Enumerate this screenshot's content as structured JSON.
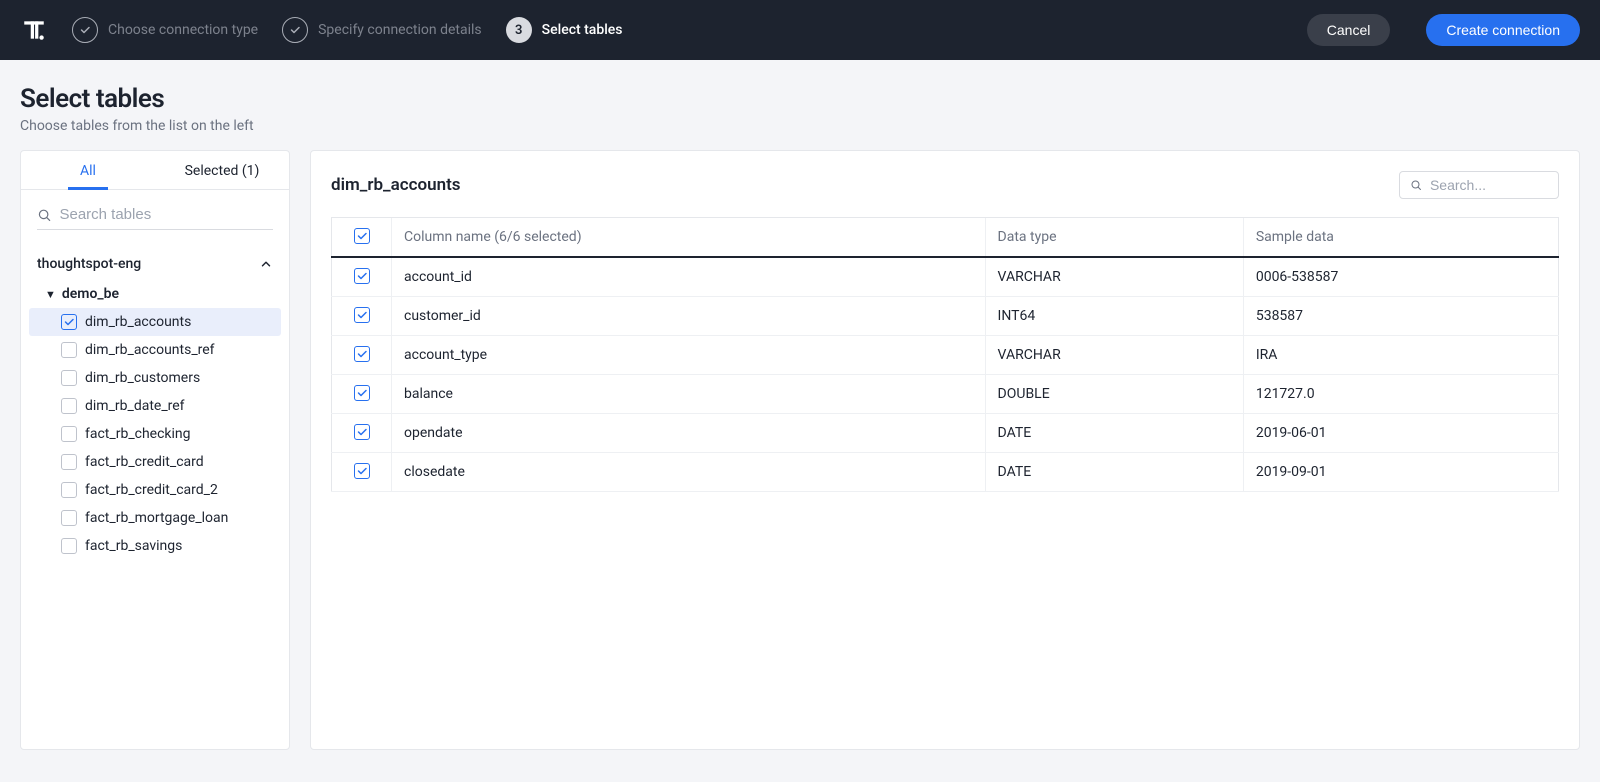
{
  "header": {
    "steps": [
      {
        "label": "Choose connection type",
        "state": "done"
      },
      {
        "label": "Specify connection details",
        "state": "done"
      },
      {
        "number": "3",
        "label": "Select tables",
        "state": "current"
      }
    ],
    "cancel": "Cancel",
    "create": "Create connection"
  },
  "page": {
    "title": "Select tables",
    "subtitle": "Choose tables from the list on the left"
  },
  "sidebar": {
    "tabs": {
      "all": "All",
      "selected": "Selected (1)"
    },
    "search_placeholder": "Search tables",
    "database": "thoughtspot-eng",
    "schema": "demo_be",
    "tables": [
      {
        "name": "dim_rb_accounts",
        "checked": true,
        "selected": true
      },
      {
        "name": "dim_rb_accounts_ref",
        "checked": false
      },
      {
        "name": "dim_rb_customers",
        "checked": false
      },
      {
        "name": "dim_rb_date_ref",
        "checked": false
      },
      {
        "name": "fact_rb_checking",
        "checked": false
      },
      {
        "name": "fact_rb_credit_card",
        "checked": false
      },
      {
        "name": "fact_rb_credit_card_2",
        "checked": false
      },
      {
        "name": "fact_rb_mortgage_loan",
        "checked": false
      },
      {
        "name": "fact_rb_savings",
        "checked": false
      }
    ]
  },
  "main": {
    "table_name": "dim_rb_accounts",
    "search_placeholder": "Search...",
    "headers": {
      "col_name": "Column name (6/6 selected)",
      "data_type": "Data type",
      "sample": "Sample data"
    },
    "columns": [
      {
        "name": "account_id",
        "type": "VARCHAR",
        "sample": "0006-538587",
        "checked": true
      },
      {
        "name": "customer_id",
        "type": "INT64",
        "sample": "538587",
        "checked": true
      },
      {
        "name": "account_type",
        "type": "VARCHAR",
        "sample": "IRA",
        "checked": true
      },
      {
        "name": "balance",
        "type": "DOUBLE",
        "sample": "121727.0",
        "checked": true
      },
      {
        "name": "opendate",
        "type": "DATE",
        "sample": "2019-06-01",
        "checked": true
      },
      {
        "name": "closedate",
        "type": "DATE",
        "sample": "2019-09-01",
        "checked": true
      }
    ]
  }
}
